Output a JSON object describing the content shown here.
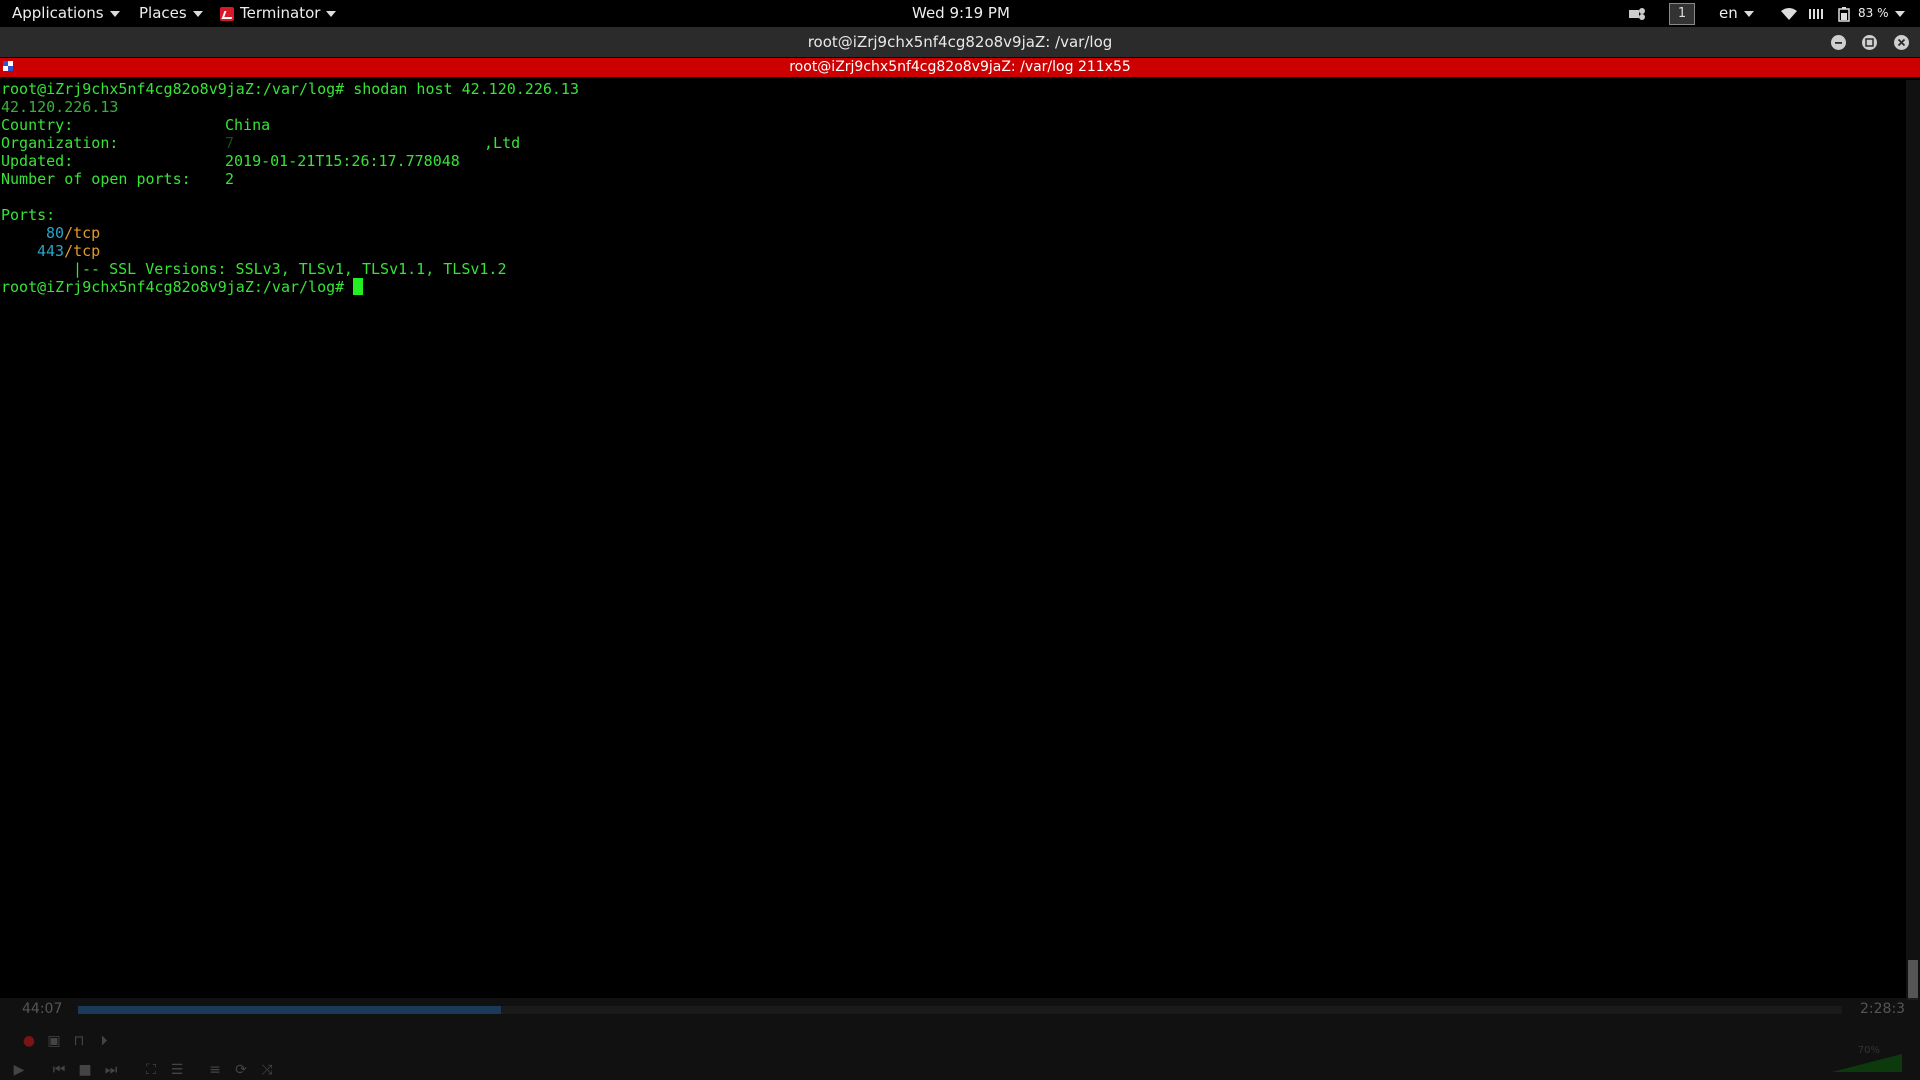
{
  "topbar": {
    "applications": "Applications",
    "places": "Places",
    "terminator": "Terminator",
    "clock": "Wed  9:19 PM",
    "workspace": "1",
    "lang": "en",
    "battery": "83 %"
  },
  "window": {
    "title": "root@iZrj9chx5nf4cg82o8v9jaZ: /var/log",
    "pane_title": "root@iZrj9chx5nf4cg82o8v9jaZ: /var/log 211x55"
  },
  "terminal": {
    "prompt": "root@iZrj9chx5nf4cg82o8v9jaZ:/var/log# ",
    "command": "shodan host 42.120.226.13",
    "ip": "42.120.226.13",
    "country_label": "Country:",
    "country_value": "China",
    "org_label": "Organization:",
    "org_prefix": "7",
    "org_suffix": ",Ltd",
    "updated_label": "Updated:",
    "updated_value": "2019-01-21T15:26:17.778048",
    "ports_count_label": "Number of open ports:",
    "ports_count_value": "2",
    "ports_label": "Ports:",
    "ports": [
      {
        "num": "80",
        "proto": "/tcp"
      },
      {
        "num": "443",
        "proto": "/tcp"
      }
    ],
    "ssl_line": "|-- SSL Versions: SSLv3, TLSv1, TLSv1.1, TLSv1.2",
    "prompt2": "root@iZrj9chx5nf4cg82o8v9jaZ:/var/log# "
  },
  "player": {
    "elapsed": "44:07",
    "total": "2:28:3",
    "progress": 0.24,
    "volume": "70%"
  }
}
